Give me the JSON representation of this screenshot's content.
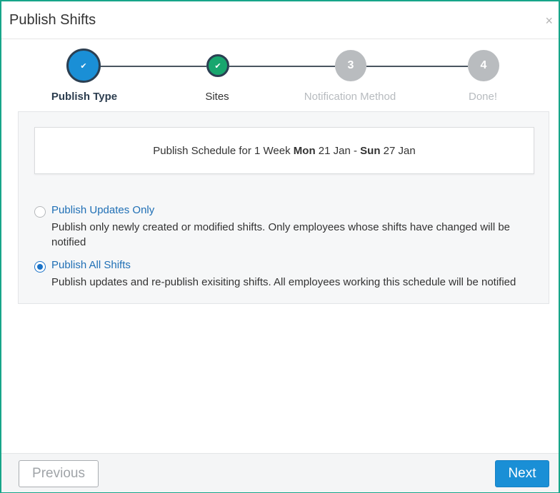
{
  "dialog": {
    "title": "Publish Shifts",
    "close_glyph": "×"
  },
  "stepper": {
    "steps": [
      {
        "label": "Publish Type",
        "marker": "✔",
        "state": "active-complete"
      },
      {
        "label": "Sites",
        "marker": "✔",
        "state": "complete"
      },
      {
        "label": "Notification Method",
        "marker": "3",
        "state": "pending"
      },
      {
        "label": "Done!",
        "marker": "4",
        "state": "pending"
      }
    ]
  },
  "schedule": {
    "prefix": "Publish Schedule for 1 Week ",
    "start_day": "Mon",
    "start_date": " 21 Jan - ",
    "end_day": "Sun",
    "end_date": " 27 Jan"
  },
  "options": [
    {
      "label": "Publish Updates Only",
      "description": "Publish only newly created or modified shifts. Only employees whose shifts have changed will be notified",
      "checked": false
    },
    {
      "label": "Publish All Shifts",
      "description": "Publish updates and re-publish exisiting shifts. All employees working this schedule will be notified",
      "checked": true
    }
  ],
  "footer": {
    "previous_label": "Previous",
    "next_label": "Next"
  },
  "colors": {
    "accent": "#1a8fd6",
    "success": "#18a66e",
    "frame": "#17a589",
    "pending": "#b9bcbf"
  }
}
